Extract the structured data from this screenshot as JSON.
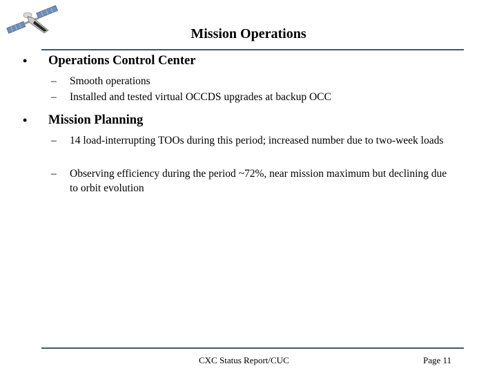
{
  "slide": {
    "title": "Mission Operations",
    "logo_icon": "satellite-icon",
    "sections": [
      {
        "heading": "Operations Control Center",
        "bullet": "•",
        "items": [
          {
            "dash": "–",
            "text": "Smooth operations"
          },
          {
            "dash": "–",
            "text": "Installed and tested virtual OCCDS upgrades at backup OCC"
          }
        ]
      },
      {
        "heading": "Mission Planning",
        "bullet": "•",
        "items": [
          {
            "dash": "–",
            "text": "14 load-interrupting TOOs during this period; increased number due to two-week loads"
          },
          {
            "dash": "–",
            "text": "Observing efficiency during the period ~72%, near mission maximum but declining due to orbit evolution"
          }
        ]
      }
    ],
    "footer": {
      "center": "CXC Status Report/CUC",
      "page": "Page 11"
    },
    "colors": {
      "rule": "#3e5a66",
      "panel": "#5c7fa8"
    }
  }
}
